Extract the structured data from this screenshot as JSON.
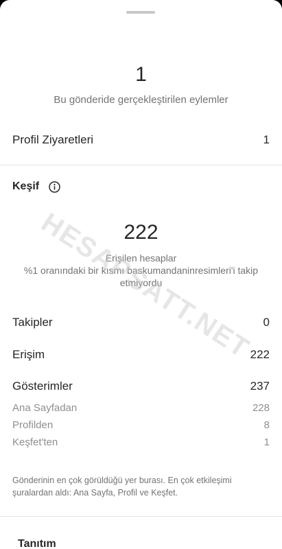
{
  "actions": {
    "count": "1",
    "caption": "Bu gönderide gerçekleştirilen eylemler"
  },
  "profile_visits": {
    "label": "Profil Ziyaretleri",
    "value": "1"
  },
  "discovery": {
    "title": "Keşif",
    "info_icon": "info-circle-icon",
    "reach": "222",
    "reach_label": "Erişilen hesaplar",
    "reach_note": "%1 oranındaki bir kısmı baskumandaninresimleri'i takip etmiyordu",
    "rows": [
      {
        "label": "Takipler",
        "value": "0"
      },
      {
        "label": "Erişim",
        "value": "222"
      },
      {
        "label": "Gösterimler",
        "value": "237"
      }
    ],
    "sub_rows": [
      {
        "label": "Ana Sayfadan",
        "value": "228"
      },
      {
        "label": "Profilden",
        "value": "8"
      },
      {
        "label": "Keşfet'ten",
        "value": "1"
      }
    ],
    "footnote": "Gönderinin en çok görüldüğü yer burası. En çok etkileşimi şuralardan aldı: Ana Sayfa, Profil ve Keşfet."
  },
  "promotion": {
    "title": "Tanıtım"
  },
  "watermark": "HESAPSATT.NET"
}
